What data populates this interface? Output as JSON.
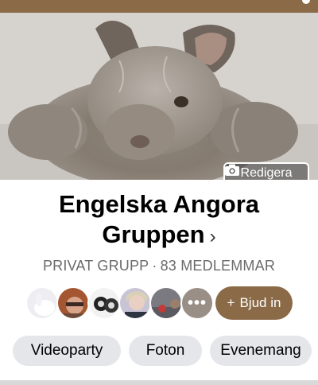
{
  "group": {
    "name": "Engelska Angora Gruppen",
    "chevron": "›",
    "privacy": "PRIVAT GRUPP",
    "separator": "·",
    "members": "83 MEDLEMMAR"
  },
  "cover": {
    "edit_label": "Redigera",
    "edit_icon": "camera-icon"
  },
  "invite": {
    "plus": "+",
    "label": "Bjud in"
  },
  "avatars": {
    "more_label": "•••"
  },
  "chips": [
    "Videoparty",
    "Foton",
    "Evenemang"
  ],
  "colors": {
    "accent": "#8a6a47",
    "chip_bg": "#e4e6ea",
    "subtitle": "#6b6b6b"
  }
}
